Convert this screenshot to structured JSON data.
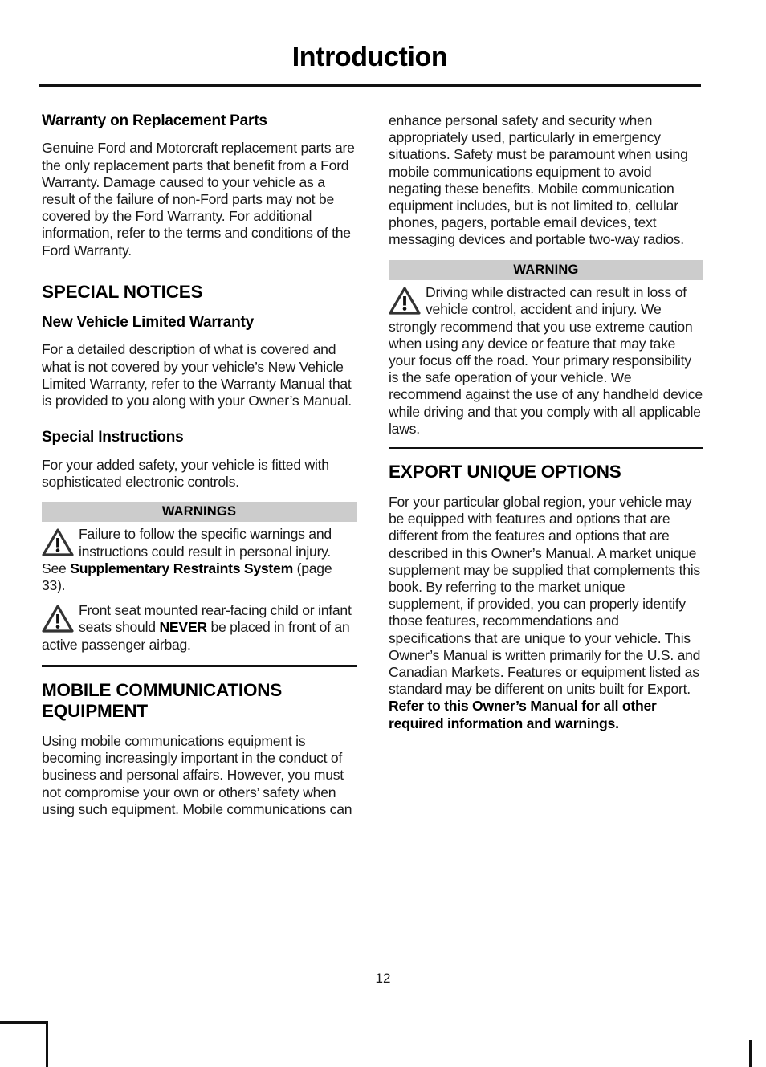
{
  "header": {
    "title": "Introduction"
  },
  "left_column": {
    "warranty_heading": "Warranty on Replacement Parts",
    "warranty_body": "Genuine Ford and Motorcraft replacement parts are the only replacement parts that benefit from a Ford Warranty. Damage caused to your vehicle as a result of the failure of non-Ford parts may not be covered by the Ford Warranty. For additional information, refer to the terms and conditions of the Ford Warranty.",
    "special_notices_heading": "SPECIAL NOTICES",
    "new_vehicle_heading": "New Vehicle Limited Warranty",
    "new_vehicle_body": "For a detailed description of what is covered and what is not covered by your vehicle’s New Vehicle Limited Warranty, refer to the Warranty Manual that is provided to you along with your Owner’s Manual.",
    "special_instructions_heading": "Special Instructions",
    "special_instructions_body": "For your added safety, your vehicle is fitted with sophisticated electronic controls.",
    "warnings_box": {
      "header": "WARNINGS",
      "item1_part1": "Failure to follow the specific warnings and instructions could result in personal injury.  See ",
      "item1_bold": "Supplementary Restraints System",
      "item1_part2": " (page 33).",
      "item2_part1": "Front seat mounted rear-facing child or infant seats should ",
      "item2_bold": "NEVER",
      "item2_part2": " be placed in front of an active passenger airbag."
    },
    "mobile_comms_heading": "MOBILE COMMUNICATIONS EQUIPMENT",
    "mobile_comms_body": "Using mobile communications equipment is becoming increasingly important in the conduct of business and personal affairs. However, you must not compromise your own or others’ safety when using such equipment. Mobile communications can"
  },
  "right_column": {
    "mobile_comms_continued": "enhance personal safety and security when appropriately used, particularly in emergency situations. Safety must be paramount when using mobile communications equipment to avoid negating these benefits. Mobile communication equipment includes, but is not limited to, cellular phones, pagers, portable email devices, text messaging devices and portable two-way radios.",
    "warning_box": {
      "header": "WARNING",
      "text": "Driving while distracted can result in loss of vehicle control, accident and injury. We strongly recommend that you use extreme caution when using any device or feature that may take your focus off the road. Your primary responsibility is the safe operation of your vehicle. We recommend against the use of any handheld device while driving and that you comply with all applicable laws."
    },
    "export_heading": "EXPORT UNIQUE OPTIONS",
    "export_body_part1": "For your particular global region, your vehicle may be equipped with features and options that are different from the features and options that are described in this Owner’s Manual. A market unique supplement may be supplied that complements this book. By referring to the market unique supplement, if provided, you can properly identify those features, recommendations and specifications that are unique to your vehicle. This Owner’s Manual is written primarily for the U.S. and Canadian Markets. Features or equipment listed as standard may be different on units built for Export. ",
    "export_body_bold": "Refer to this Owner’s Manual for all other required information and warnings."
  },
  "footer": {
    "page_number": "12"
  },
  "icons": {
    "warning_triangle": "warning-triangle-icon"
  },
  "colors": {
    "warning_header_bg": "#cccccc",
    "text": "#1a1a1a",
    "rule": "#111111"
  }
}
